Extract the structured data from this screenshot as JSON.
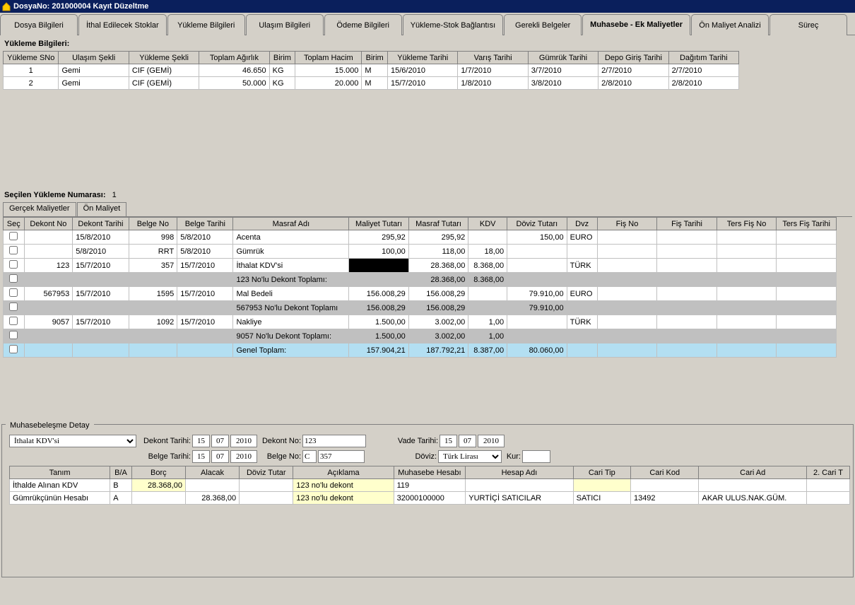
{
  "title": "DosyaNo: 201000004 Kayıt Düzeltme",
  "mainTabs": [
    "Dosya Bilgileri",
    "İthal Edilecek Stoklar",
    "Yükleme Bilgileri",
    "Ulaşım Bilgileri",
    "Ödeme Bilgileri",
    "Yükleme-Stok Bağlantısı",
    "Gerekli Belgeler",
    "Muhasebe - Ek Maliyetler",
    "Ön Maliyet Analizi",
    "Süreç"
  ],
  "activeMainTab": 7,
  "sec1": {
    "title": "Yükleme Bilgileri:",
    "headers": [
      "Yükleme SNo",
      "Ulaşım Şekli",
      "Yükleme Şekli",
      "Toplam Ağırlık",
      "Birim",
      "Toplam Hacim",
      "Birim",
      "Yükleme Tarihi",
      "Varış Tarihi",
      "Gümrük Tarihi",
      "Depo Giriş Tarihi",
      "Dağıtım Tarihi"
    ],
    "rows": [
      {
        "sno": "1",
        "ulasim": "Gemi",
        "yukleme": "CIF (GEMİ)",
        "agirlik": "46.650",
        "b1": "KG",
        "hacim": "15.000",
        "b2": "M",
        "yt": "15/6/2010",
        "vt": "1/7/2010",
        "gt": "3/7/2010",
        "dgt": "2/7/2010",
        "dt": "2/7/2010"
      },
      {
        "sno": "2",
        "ulasim": "Gemi",
        "yukleme": "CIF (GEMİ)",
        "agirlik": "50.000",
        "b1": "KG",
        "hacim": "20.000",
        "b2": "M",
        "yt": "15/7/2010",
        "vt": "1/8/2010",
        "gt": "3/8/2010",
        "dgt": "2/8/2010",
        "dt": "2/8/2010"
      }
    ]
  },
  "sec2": {
    "label": "Seçilen Yükleme Numarası:",
    "value": "1",
    "subTabs": [
      "Gerçek Maliyetler",
      "Ön Maliyet"
    ],
    "headers": [
      "Seç",
      "Dekont No",
      "Dekont Tarihi",
      "Belge No",
      "Belge Tarihi",
      "Masraf Adı",
      "Maliyet Tutarı",
      "Masraf Tutarı",
      "KDV",
      "Döviz Tutarı",
      "Dvz",
      "Fiş No",
      "Fiş Tarihi",
      "Ters Fiş No",
      "Ters Fiş Tarihi"
    ],
    "rows": [
      {
        "type": "n",
        "dn": "",
        "dt": "15/8/2010",
        "bn": "998",
        "bt": "5/8/2010",
        "ma": "Acenta",
        "mt": "295,92",
        "mst": "295,92",
        "kdv": "",
        "dov": "150,00",
        "dvz": "EURO"
      },
      {
        "type": "n",
        "dn": "",
        "dt": "5/8/2010",
        "bn": "RRT",
        "bt": "5/8/2010",
        "ma": "Gümrük",
        "mt": "100,00",
        "mst": "118,00",
        "kdv": "18,00",
        "dov": "",
        "dvz": ""
      },
      {
        "type": "n",
        "dn": "123",
        "dt": "15/7/2010",
        "bn": "357",
        "bt": "15/7/2010",
        "ma": "İthalat KDV'si",
        "mt": "__BLACK__",
        "mst": "28.368,00",
        "kdv": "8.368,00",
        "dov": "",
        "dvz": "TÜRK"
      },
      {
        "type": "g",
        "ma": "123 No'lu Dekont Toplamı:",
        "mt": "",
        "mst": "28.368,00",
        "kdv": "8.368,00",
        "dov": ""
      },
      {
        "type": "n",
        "dn": "567953",
        "dt": "15/7/2010",
        "bn": "1595",
        "bt": "15/7/2010",
        "ma": "Mal Bedeli",
        "mt": "156.008,29",
        "mst": "156.008,29",
        "kdv": "",
        "dov": "79.910,00",
        "dvz": "EURO"
      },
      {
        "type": "g",
        "ma": "567953 No'lu Dekont Toplamı",
        "mt": "156.008,29",
        "mst": "156.008,29",
        "kdv": "",
        "dov": "79.910,00"
      },
      {
        "type": "n",
        "dn": "9057",
        "dt": "15/7/2010",
        "bn": "1092",
        "bt": "15/7/2010",
        "ma": "Nakliye",
        "mt": "1.500,00",
        "mst": "3.002,00",
        "kdv": "1,00",
        "dov": "",
        "dvz": "TÜRK"
      },
      {
        "type": "g",
        "ma": "9057 No'lu Dekont Toplamı:",
        "mt": "1.500,00",
        "mst": "3.002,00",
        "kdv": "1,00",
        "dov": ""
      },
      {
        "type": "b",
        "ma": "Genel Toplam:",
        "mt": "157.904,21",
        "mst": "187.792,21",
        "kdv": "8.387,00",
        "dov": "80.060,00"
      }
    ]
  },
  "detail": {
    "title": "Muhasebeleşme Detay",
    "type": "İthalat KDV'si",
    "dekontTarihiL": "Dekont Tarihi:",
    "belgeTarihiL": "Belge Tarihi:",
    "dekontNoL": "Dekont No:",
    "belgeNoL": "Belge No:",
    "vadeTarihiL": "Vade Tarihi:",
    "dovizL": "Döviz:",
    "kurL": "Kur:",
    "dekontTarihi": {
      "d": "15",
      "m": "07",
      "y": "2010"
    },
    "belgeTarihi": {
      "d": "15",
      "m": "07",
      "y": "2010"
    },
    "vadeTarihi": {
      "d": "15",
      "m": "07",
      "y": "2010"
    },
    "dekontNo": "123",
    "belgeNoPrefix": "C",
    "belgeNo": "357",
    "doviz": "Türk Lirası",
    "kur": "",
    "headers": [
      "Tanım",
      "B/A",
      "Borç",
      "Alacak",
      "Döviz Tutar",
      "Açıklama",
      "Muhasebe Hesabı",
      "Hesap Adı",
      "Cari Tip",
      "Cari Kod",
      "Cari Ad",
      "2. Cari T"
    ],
    "rows": [
      {
        "tanim": "İthalde Alınan KDV",
        "ba": "B",
        "borc": "28.368,00",
        "alacak": "",
        "dt": "",
        "acik": "123 no'lu dekont",
        "mh": "119",
        "ha": "",
        "ct": "",
        "ck": "",
        "ca": ""
      },
      {
        "tanim": "Gümrükçünün Hesabı",
        "ba": "A",
        "borc": "",
        "alacak": "28.368,00",
        "dt": "",
        "acik": "123 no'lu dekont",
        "mh": "32000100000",
        "ha": "YURTİÇİ SATICILAR",
        "ct": "SATICI",
        "ck": "13492",
        "ca": "AKAR ULUS.NAK.GÜM."
      }
    ]
  }
}
